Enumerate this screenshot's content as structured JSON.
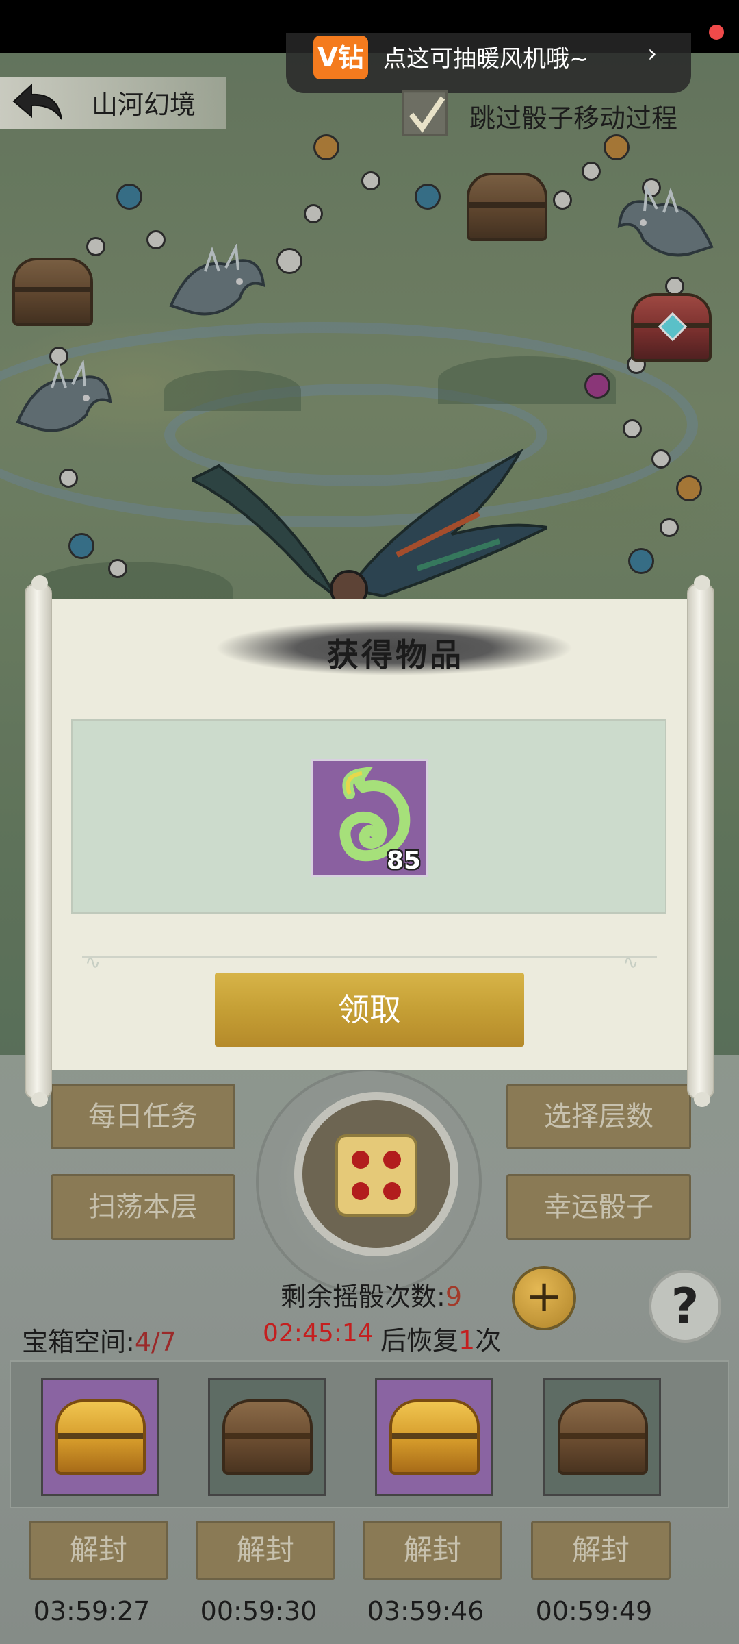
{
  "header": {
    "title": "山河幻境",
    "vip_badge": "V钻",
    "vip_text": "点这可抽暖风机哦~",
    "skip_label": "跳过骰子移动过程"
  },
  "dialog": {
    "title": "获得物品",
    "item": {
      "name": "jade-item",
      "quantity": "85"
    },
    "claim_label": "领取"
  },
  "panel": {
    "buttons": {
      "daily_tasks": "每日任务",
      "select_floor": "选择层数",
      "sweep_floor": "扫荡本层",
      "lucky_dice": "幸运骰子"
    },
    "dice_face": 4,
    "rolls_label": "剩余摇骰次数:",
    "rolls_count": "9",
    "chest_space_label": "宝箱空间:",
    "chest_space_value": "4/7",
    "recover_timer": "02:45:14",
    "recover_prefix": "后恢复",
    "recover_count": "1",
    "recover_suffix": "次"
  },
  "chests": [
    {
      "type": "gold",
      "slot_color": "purple",
      "button": "解封",
      "time": "03:59:27"
    },
    {
      "type": "brown",
      "slot_color": "green",
      "button": "解封",
      "time": "00:59:30"
    },
    {
      "type": "gold",
      "slot_color": "purple",
      "button": "解封",
      "time": "03:59:46"
    },
    {
      "type": "brown",
      "slot_color": "green",
      "button": "解封",
      "time": "00:59:49"
    }
  ],
  "colors": {
    "accent_gold": "#c59f35",
    "vip_orange": "#f47b1e",
    "timer_red": "#c41f1f",
    "item_purple": "#8a60a0"
  }
}
